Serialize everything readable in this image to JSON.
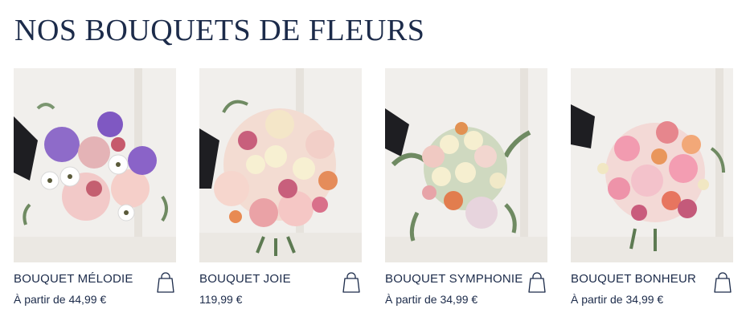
{
  "page": {
    "title": "NOS BOUQUETS DE FLEURS"
  },
  "products": [
    {
      "name": "BOUQUET MÉLODIE",
      "price": "À partir de 44,99 €",
      "icon": "shopping-bag-icon"
    },
    {
      "name": "BOUQUET JOIE",
      "price": "119,99 €",
      "icon": "shopping-bag-icon"
    },
    {
      "name": "BOUQUET SYMPHONIE",
      "price": "À partir de 34,99 €",
      "icon": "shopping-bag-icon"
    },
    {
      "name": "BOUQUET BONHEUR",
      "price": "À partir de 34,99 €",
      "icon": "shopping-bag-icon"
    }
  ],
  "colors": {
    "text": "#1c2b4a",
    "background": "#ffffff"
  }
}
